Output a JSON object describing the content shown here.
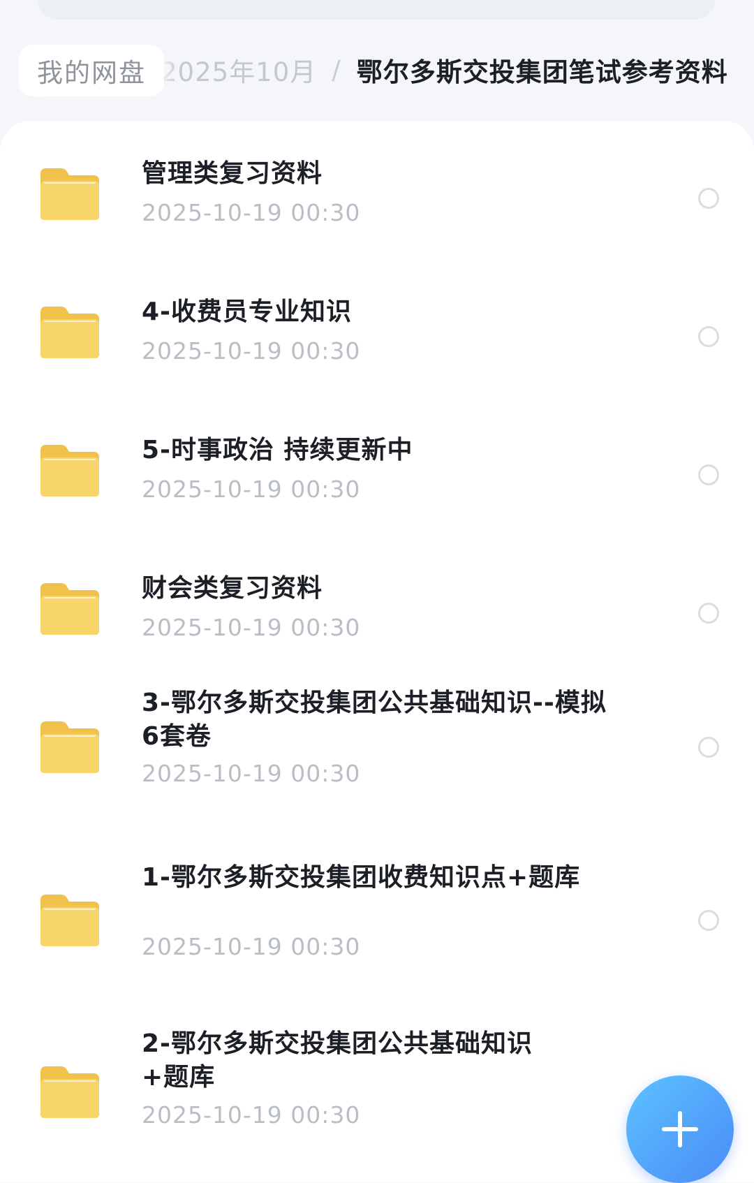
{
  "breadcrumb": {
    "root": "我的网盘",
    "previous": "2025年10月",
    "separator": "/",
    "current": "鄂尔多斯交投集团笔试参考资料"
  },
  "files": [
    {
      "name": "管理类复习资料",
      "date": "2025-10-19 00:30",
      "icon": "folder-icon",
      "selected": false
    },
    {
      "name": "4-收费员专业知识",
      "date": "2025-10-19 00:30",
      "icon": "folder-icon",
      "selected": false
    },
    {
      "name": "5-时事政治 持续更新中",
      "date": "2025-10-19 00:30",
      "icon": "folder-icon",
      "selected": false
    },
    {
      "name": "财会类复习资料",
      "date": "2025-10-19 00:30",
      "icon": "folder-icon",
      "selected": false
    },
    {
      "name": "3-鄂尔多斯交投集团公共基础知识--模拟6套卷",
      "date": "2025-10-19 00:30",
      "icon": "folder-icon",
      "selected": false
    },
    {
      "name": "1-鄂尔多斯交投集团收费知识点+题库",
      "date": "2025-10-19 00:30",
      "icon": "folder-icon",
      "selected": false
    },
    {
      "name": "2-鄂尔多斯交投集团公共基础知识+题库",
      "date": "2025-10-19 00:30",
      "icon": "folder-icon",
      "selected": false
    }
  ],
  "fab": {
    "icon": "plus-icon"
  },
  "colors": {
    "folder": "#f8d56b",
    "folder_tab": "#f0c24c",
    "fab_start": "#5cc2ff",
    "fab_end": "#4a8bf7",
    "date_text": "#b9bdc5",
    "title_text": "#1c1f26"
  }
}
